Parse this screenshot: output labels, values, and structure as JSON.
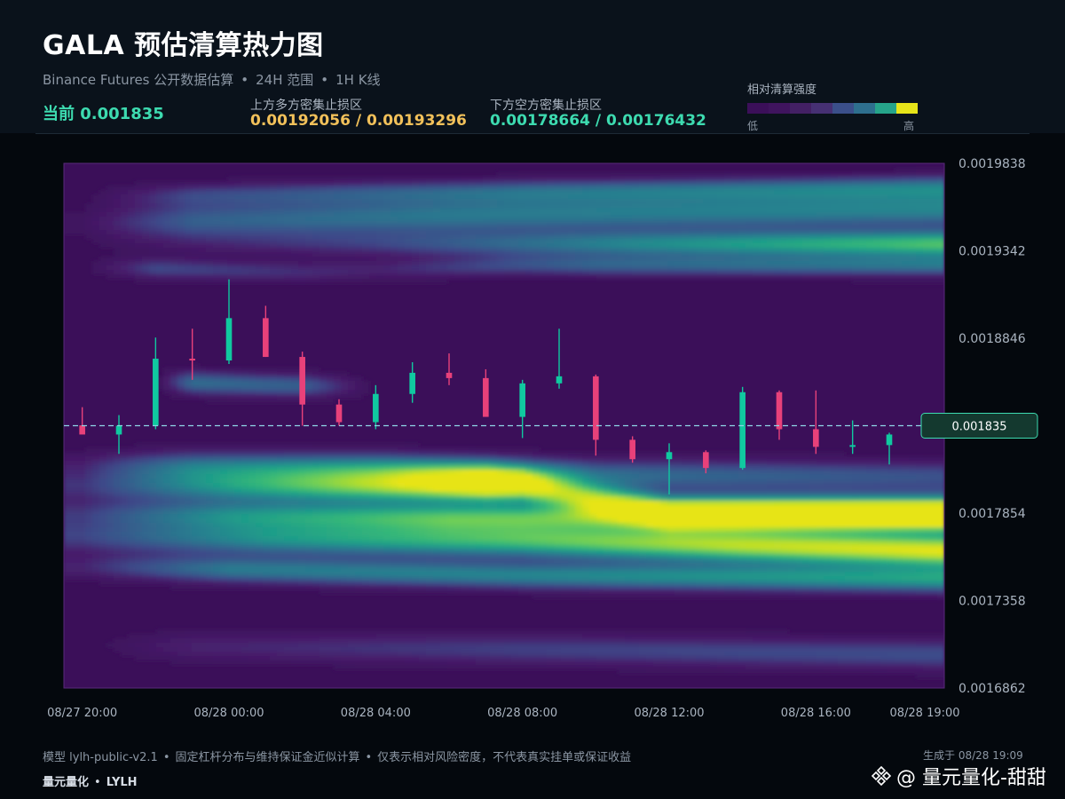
{
  "header": {
    "title": "GALA 预估清算热力图",
    "subtitle_source": "Binance Futures 公开数据估算",
    "subtitle_range": "24H 范围",
    "subtitle_interval": "1H K线",
    "subtitle_sep": "•",
    "current": "当前 0.001835",
    "upper_label": "上方多方密集止损区",
    "upper_value": "0.00192056 / 0.00193296",
    "upper_color": "#f2c15a",
    "lower_label": "下方空方密集止损区",
    "lower_value": "0.00178664 / 0.00176432",
    "lower_color": "#3ddbb0"
  },
  "legend": {
    "title": "相对清算强度",
    "low": "低",
    "high": "高",
    "colors": [
      "#3b0f59",
      "#3f145e",
      "#432064",
      "#463073",
      "#3b4f8a",
      "#2e6f8e",
      "#26a48a",
      "#e7e419"
    ]
  },
  "chart_data": {
    "type": "heatmap",
    "title": "",
    "xlabel": "",
    "ylabel": "",
    "ylim": [
      0.0016862,
      0.0019838
    ],
    "y_ticks": [
      "0.0019838",
      "0.0019342",
      "0.0018846",
      "0.0018354",
      "0.0017854",
      "0.0017358",
      "0.0016862"
    ],
    "y_tick_values": [
      0.0019838,
      0.0019342,
      0.0018846,
      0.0018354,
      0.0017854,
      0.0017358,
      0.0016862
    ],
    "x_ticks": [
      "08/27 20:00",
      "08/28 00:00",
      "08/28 04:00",
      "08/28 08:00",
      "08/28 12:00",
      "08/28 16:00",
      "08/28 19:00"
    ],
    "x_tick_hours": [
      0,
      4,
      8,
      12,
      16,
      20,
      23
    ],
    "x_range_hours": [
      -0.5,
      23.5
    ],
    "current_price": 0.001835,
    "current_price_label": "0.001835",
    "up_color": "#10c9a0",
    "down_color": "#e8417a",
    "colorscale": [
      "#3b0f59",
      "#471d6b",
      "#3e4989",
      "#31688e",
      "#26838f",
      "#1f9e89",
      "#35b779",
      "#6ece58",
      "#b5de2b",
      "#e7e419"
    ],
    "candles": [
      {
        "time": "08/27 20:00",
        "open": 0.0018352,
        "high": 0.0018455,
        "low": 0.0018305,
        "close": 0.00183
      },
      {
        "time": "08/27 21:00",
        "open": 0.00183,
        "high": 0.001841,
        "low": 0.001819,
        "close": 0.001835
      },
      {
        "time": "08/27 22:00",
        "open": 0.001835,
        "high": 0.001885,
        "low": 0.001833,
        "close": 0.001873
      },
      {
        "time": "08/27 23:00",
        "open": 0.001873,
        "high": 0.00189,
        "low": 0.001861,
        "close": 0.001872
      },
      {
        "time": "08/28 00:00",
        "open": 0.001872,
        "high": 0.001918,
        "low": 0.00187,
        "close": 0.001896
      },
      {
        "time": "08/28 01:00",
        "open": 0.001896,
        "high": 0.001903,
        "low": 0.001874,
        "close": 0.001874
      },
      {
        "time": "08/28 02:00",
        "open": 0.001874,
        "high": 0.001877,
        "low": 0.001835,
        "close": 0.001847
      },
      {
        "time": "08/28 03:00",
        "open": 0.001847,
        "high": 0.00185,
        "low": 0.001835,
        "close": 0.001837
      },
      {
        "time": "08/28 04:00",
        "open": 0.001837,
        "high": 0.001858,
        "low": 0.001833,
        "close": 0.001853
      },
      {
        "time": "08/28 05:00",
        "open": 0.001853,
        "high": 0.001871,
        "low": 0.001848,
        "close": 0.001865
      },
      {
        "time": "08/28 06:00",
        "open": 0.001865,
        "high": 0.001876,
        "low": 0.001858,
        "close": 0.001862
      },
      {
        "time": "08/28 07:00",
        "open": 0.001862,
        "high": 0.001867,
        "low": 0.001841,
        "close": 0.00184
      },
      {
        "time": "08/28 08:00",
        "open": 0.00184,
        "high": 0.001861,
        "low": 0.001828,
        "close": 0.001859
      },
      {
        "time": "08/28 09:00",
        "open": 0.001859,
        "high": 0.00189,
        "low": 0.001856,
        "close": 0.001863
      },
      {
        "time": "08/28 10:00",
        "open": 0.001863,
        "high": 0.001864,
        "low": 0.001818,
        "close": 0.001827
      },
      {
        "time": "08/28 11:00",
        "open": 0.001827,
        "high": 0.001829,
        "low": 0.001814,
        "close": 0.001816
      },
      {
        "time": "08/28 12:00",
        "open": 0.001816,
        "high": 0.001825,
        "low": 0.001796,
        "close": 0.00182
      },
      {
        "time": "08/28 13:00",
        "open": 0.00182,
        "high": 0.001821,
        "low": 0.001808,
        "close": 0.001811
      },
      {
        "time": "08/28 14:00",
        "open": 0.001811,
        "high": 0.001857,
        "low": 0.00181,
        "close": 0.001854
      },
      {
        "time": "08/28 15:00",
        "open": 0.001854,
        "high": 0.001855,
        "low": 0.001827,
        "close": 0.001833
      },
      {
        "time": "08/28 16:00",
        "open": 0.001833,
        "high": 0.001855,
        "low": 0.001819,
        "close": 0.001823
      },
      {
        "time": "08/28 17:00",
        "open": 0.001823,
        "high": 0.001838,
        "low": 0.001819,
        "close": 0.001824
      },
      {
        "time": "08/28 18:00",
        "open": 0.001824,
        "high": 0.001831,
        "low": 0.001813,
        "close": 0.00183
      }
    ]
  },
  "footer": {
    "note_model": "模型 lylh-public-v2.1",
    "note_method": "固定杠杆分布与维持保证金近似计算",
    "note_disclaimer": "仅表示相对风险密度，不代表真实挂单或保证收益",
    "sep": "•",
    "brand_cn": "量元量化",
    "brand_en": "LYLH",
    "generated": "生成于 08/28 19:09",
    "watermark": "@ 量元量化-甜甜"
  }
}
